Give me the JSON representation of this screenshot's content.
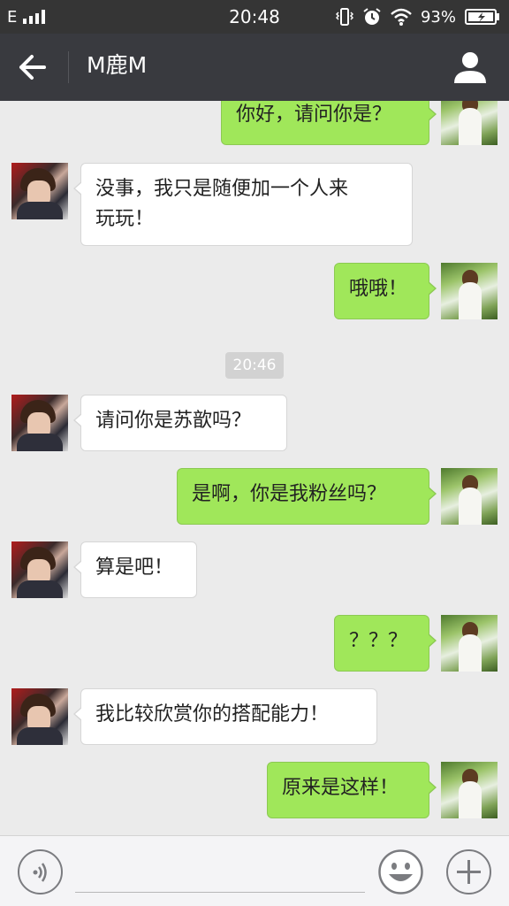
{
  "status_bar": {
    "network": "E",
    "time": "20:48",
    "battery": "93%",
    "icons": [
      "signal-icon",
      "vibrate-icon",
      "alarm-icon",
      "wifi-icon",
      "battery-icon"
    ]
  },
  "header": {
    "title": "M鹿M",
    "back_icon": "back-arrow-icon",
    "profile_icon": "person-icon"
  },
  "messages": [
    {
      "side": "right",
      "text": "你好，请问你是？"
    },
    {
      "side": "left",
      "text": "没事，我只是随便加一个人来\n玩玩！"
    },
    {
      "side": "right",
      "text": "哦哦！"
    },
    {
      "side": "left",
      "text": "请问你是苏歆吗？"
    },
    {
      "side": "right",
      "text": "是啊，你是我粉丝吗？"
    },
    {
      "side": "left",
      "text": "算是吧！"
    },
    {
      "side": "right",
      "text": "？？？"
    },
    {
      "side": "left",
      "text": "我比较欣赏你的搭配能力！"
    },
    {
      "side": "right",
      "text": "原来是这样！"
    }
  ],
  "timestamp": "20:46",
  "input_bar": {
    "voice_icon": "voice-icon",
    "input_value": "",
    "emoji_icon": "emoji-icon",
    "plus_icon": "plus-icon"
  },
  "colors": {
    "nav_background": "#393a3f",
    "chat_background": "#ebebeb",
    "outgoing_bubble": "#a0e75a",
    "incoming_bubble": "#ffffff"
  }
}
